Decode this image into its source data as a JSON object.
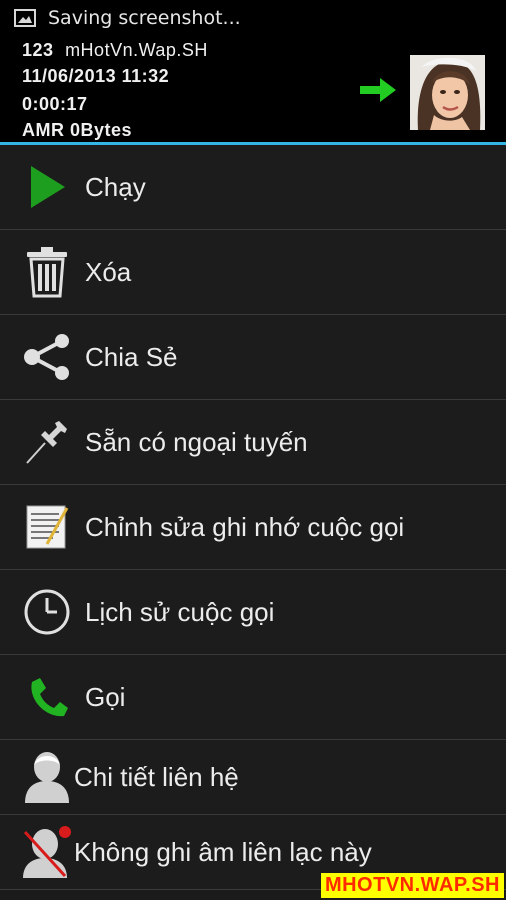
{
  "statusbar": {
    "notification": "Saving screenshot..."
  },
  "recording": {
    "number": "123",
    "name": "mHotVn.Wap.SH",
    "datetime": "11/06/2013  11:32",
    "duration": "0:00:17",
    "format": "AMR  0Bytes"
  },
  "menu": [
    {
      "label": "Chạy",
      "icon": "play-icon"
    },
    {
      "label": "Xóa",
      "icon": "trash-icon"
    },
    {
      "label": "Chia Sẻ",
      "icon": "share-icon"
    },
    {
      "label": "Sẵn có ngoại tuyến",
      "icon": "pin-icon"
    },
    {
      "label": "Chỉnh sửa ghi nhớ cuộc gọi",
      "icon": "notepad-icon"
    },
    {
      "label": "Lịch sử cuộc gọi",
      "icon": "clock-icon"
    },
    {
      "label": "Gọi",
      "icon": "phone-icon"
    },
    {
      "label": "Chi tiết liên hệ",
      "icon": "contact-icon"
    },
    {
      "label": "Không ghi âm liên lạc này",
      "icon": "contact-blocked-icon"
    }
  ],
  "watermark": "MHOTVN.WAP.SH",
  "colors": {
    "accent": "#33b5e5",
    "play": "#1e9e1e",
    "phone": "#22b322",
    "arrow": "#22cc22"
  }
}
